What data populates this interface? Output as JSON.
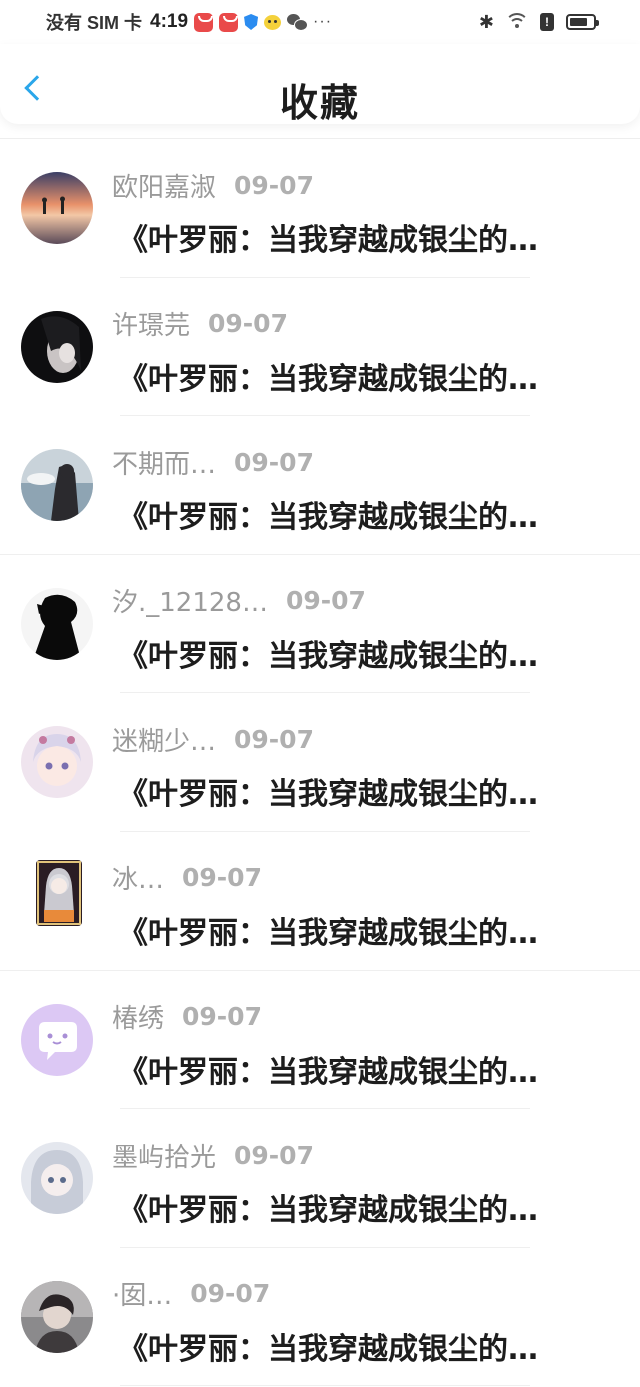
{
  "status_bar": {
    "carrier": "没有 SIM 卡",
    "time": "4:19",
    "more": "···",
    "battery_level": 0.75
  },
  "header": {
    "title": "收藏"
  },
  "favorites": [
    {
      "name": "欧阳嘉淑",
      "date": "09-07",
      "preview": "《叶罗丽：当我穿越成银尘的…",
      "avatar": "sunset-silhouette"
    },
    {
      "name": "许璟芫",
      "date": "09-07",
      "preview": "《叶罗丽：当我穿越成银尘的…",
      "avatar": "dark-portrait"
    },
    {
      "name": "不期而…",
      "date": "09-07",
      "preview": "《叶罗丽：当我穿越成银尘的…",
      "avatar": "ocean-figure"
    },
    {
      "name": "汐._12128…",
      "date": "09-07",
      "preview": "《叶罗丽：当我穿越成银尘的…",
      "avatar": "black-silhouette"
    },
    {
      "name": "迷糊少…",
      "date": "09-07",
      "preview": "《叶罗丽：当我穿越成银尘的…",
      "avatar": "anime-girl"
    },
    {
      "name": "冰…",
      "date": "09-07",
      "preview": "《叶罗丽：当我穿越成银尘的…",
      "avatar": "anime-card"
    },
    {
      "name": "椿绣",
      "date": "09-07",
      "preview": "《叶罗丽：当我穿越成银尘的…",
      "avatar": "chat-bubble-icon"
    },
    {
      "name": "墨屿拾光",
      "date": "09-07",
      "preview": "《叶罗丽：当我穿越成银尘的…",
      "avatar": "anime-silver"
    },
    {
      "name": "·囡…",
      "date": "09-07",
      "preview": "《叶罗丽：当我穿越成银尘的…",
      "avatar": "photo-portrait"
    }
  ],
  "colors": {
    "accent": "#2aa6ea",
    "name": "#9a9a9a",
    "date": "#b0b0b0",
    "message": "#1d1d1d"
  }
}
